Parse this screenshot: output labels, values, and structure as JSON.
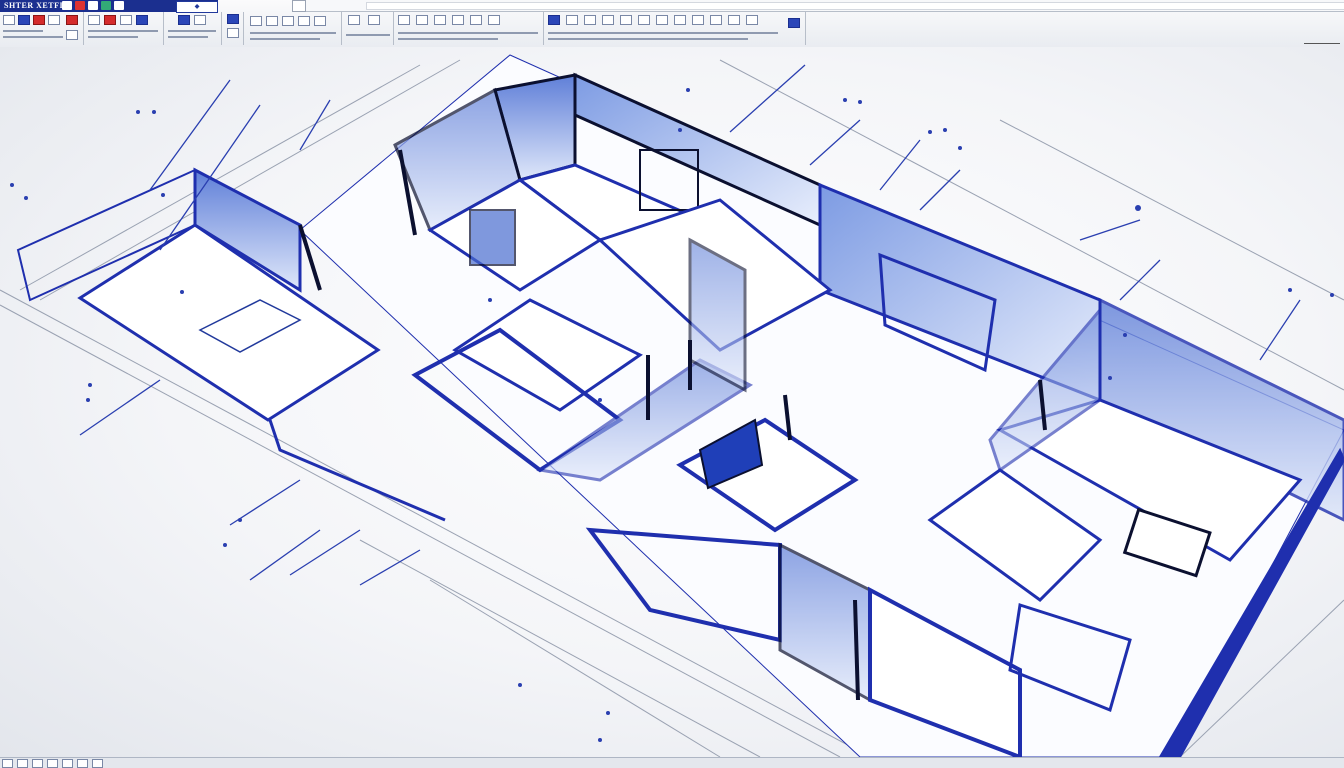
{
  "app": {
    "title": "SHTER XETFIO"
  },
  "colors": {
    "accent": "#1b2f8f",
    "wall": "#1f2fae",
    "wall_dark": "#0b1030",
    "glass": "#6f8fe0",
    "floor": "#ffffff"
  },
  "ribbon": {
    "icons": [
      "file-icon",
      "save-icon",
      "undo-icon",
      "redo-icon",
      "print-icon"
    ],
    "panels": [
      {
        "name": "home-panel"
      },
      {
        "name": "draw-panel"
      },
      {
        "name": "modify-panel"
      },
      {
        "name": "annotate-panel"
      },
      {
        "name": "layers-panel"
      },
      {
        "name": "block-panel"
      },
      {
        "name": "properties-panel"
      },
      {
        "name": "utilities-panel"
      }
    ]
  },
  "statusbar": {
    "icons": [
      "grid-icon",
      "snap-icon",
      "ortho-icon",
      "polar-icon",
      "osnap-icon",
      "otrack-icon",
      "lineweight-icon"
    ]
  }
}
